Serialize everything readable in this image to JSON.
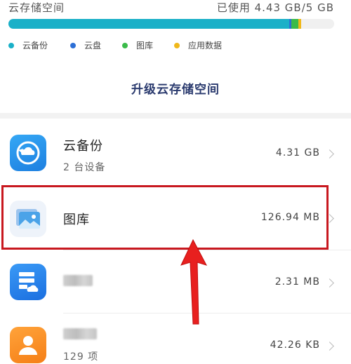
{
  "storage": {
    "title": "云存储空间",
    "usage": "已使用 4.43 GB/5 GB",
    "used_fraction": 0.886,
    "legend": [
      {
        "label": "云备份",
        "color": "#1ab0c8"
      },
      {
        "label": "云盘",
        "color": "#2c6fd6"
      },
      {
        "label": "图库",
        "color": "#3bbb4a"
      },
      {
        "label": "应用数据",
        "color": "#f0b81a"
      }
    ]
  },
  "upgrade_label": "升级云存储空间",
  "list": [
    {
      "title": "云备份",
      "subtitle": "2 台设备",
      "size": "4.31 GB",
      "icon": "cloud-backup-icon"
    },
    {
      "title": "图库",
      "subtitle": "",
      "size": "126.94 MB",
      "icon": "gallery-icon"
    },
    {
      "title": "",
      "subtitle": "",
      "size": "2.31 MB",
      "icon": "cloud-drive-icon"
    },
    {
      "title": "",
      "subtitle": "129 项",
      "size": "42.26 KB",
      "icon": "contacts-icon"
    }
  ]
}
